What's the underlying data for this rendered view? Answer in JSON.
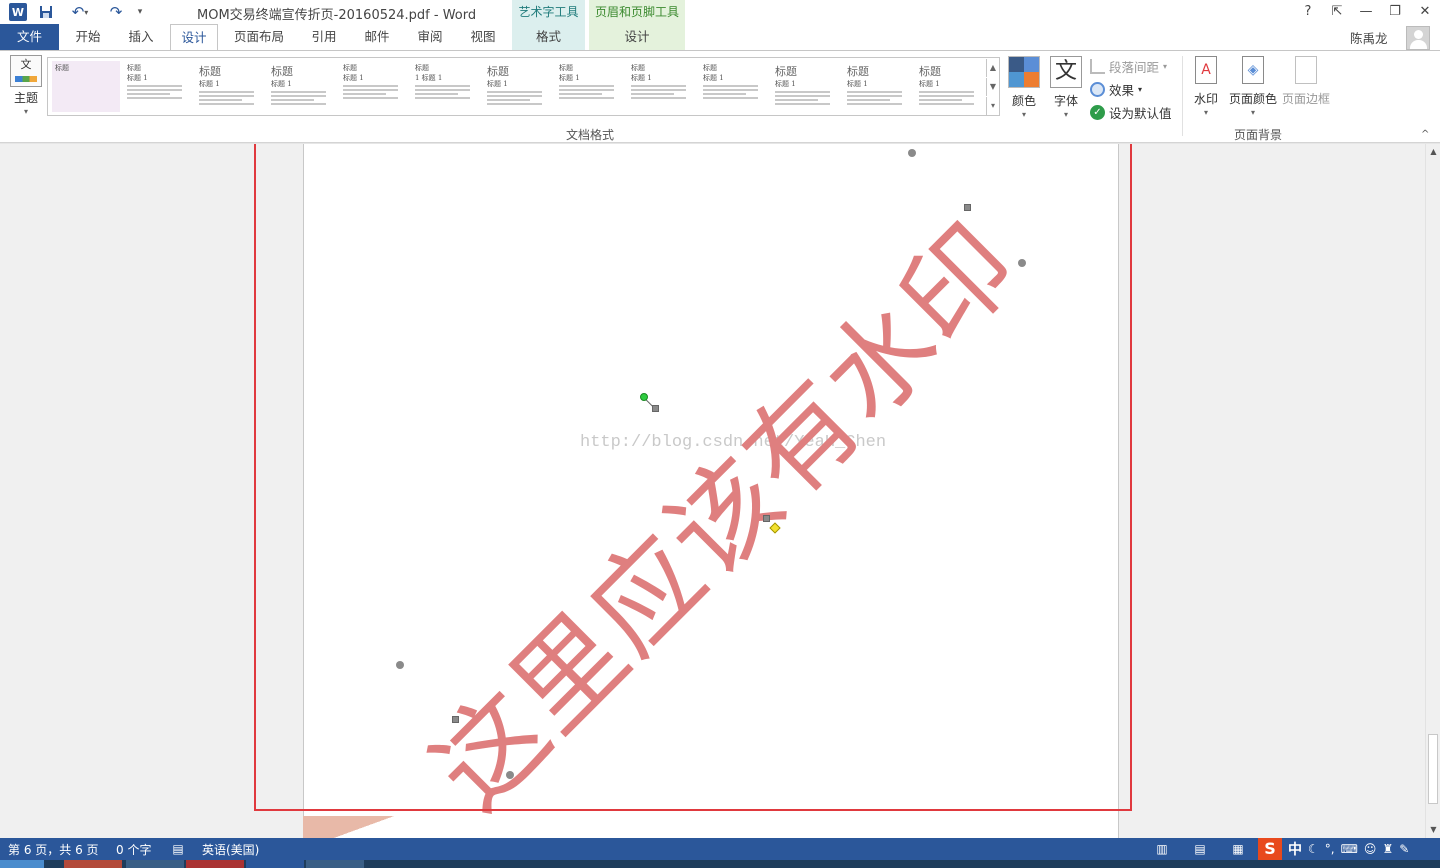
{
  "titlebar": {
    "doc_title": "MOM交易终端宣传折页-20160524.pdf - Word",
    "word_logo": "W",
    "ctx_wordart": "艺术字工具",
    "ctx_headerfooter": "页眉和页脚工具",
    "help": "?",
    "ribbon_display": "⇱",
    "minimize": "—",
    "restore": "❐",
    "close": "✕"
  },
  "tabs": {
    "file": "文件",
    "home": "开始",
    "insert": "插入",
    "design": "设计",
    "layout": "页面布局",
    "references": "引用",
    "mailings": "邮件",
    "review": "审阅",
    "view": "视图",
    "format": "格式",
    "design2": "设计"
  },
  "user": {
    "name": "陈禹龙"
  },
  "ribbon": {
    "theme_label": "主题",
    "theme_icon_text": "文",
    "gallery": {
      "items": [
        {
          "title": "标题",
          "heading": "标题 1"
        },
        {
          "title": "标题",
          "heading": "标题 1"
        },
        {
          "title": "标题",
          "heading": "标题 1"
        },
        {
          "title": "标题",
          "heading": "标题 1"
        },
        {
          "title": "标题",
          "heading": "标题 1"
        },
        {
          "title": "标题",
          "heading": "1 标题 1"
        },
        {
          "title": "标题",
          "heading": "标题 1"
        },
        {
          "title": "标题",
          "heading": "标题 1"
        },
        {
          "title": "标题",
          "heading": "标题 1"
        },
        {
          "title": "标题",
          "heading": "标题 1"
        },
        {
          "title": "标题",
          "heading": "标题 1"
        },
        {
          "title": "标题",
          "heading": "标题 1"
        },
        {
          "title": "标题",
          "heading": "标题 1"
        }
      ]
    },
    "group_doc_format": "文档格式",
    "colors_label": "颜色",
    "fonts_label": "字体",
    "fonts_icon_text": "文",
    "paragraph_spacing": "段落间距",
    "effects": "效果",
    "set_default": "设为默认值",
    "watermark_label": "水印",
    "page_color_label": "页面颜色",
    "page_borders_label": "页面边框",
    "group_page_background": "页面背景",
    "theme_colors": [
      "#3a5a87",
      "#5b8ed6",
      "#4f96d2",
      "#ed7d31"
    ]
  },
  "document": {
    "watermark_text": "这里应该有水印",
    "blog_url": "http://blog.csdn.net/YeaH_Chen",
    "watermark_color": "#df7f7f",
    "highlight_color": "#e0393e"
  },
  "statusbar": {
    "page_info": "第 6 页，共 6 页",
    "word_count": "0 个字",
    "language": "英语(美国)",
    "ime_zh": "中"
  }
}
